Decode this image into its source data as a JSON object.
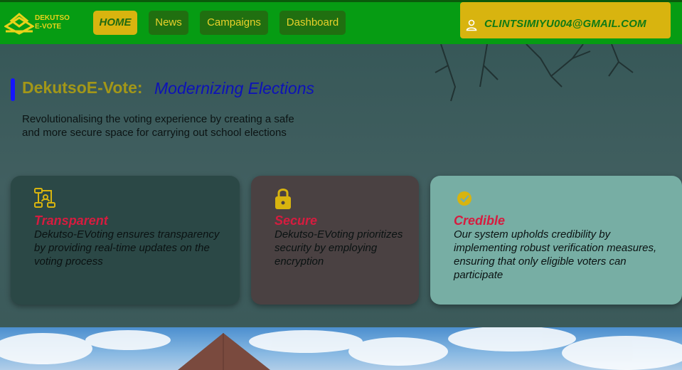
{
  "brand": {
    "name_line1": "DEKUTSO",
    "name_line2": "E-VOTE",
    "icon": "ballot-box-icon"
  },
  "nav": {
    "items": [
      {
        "label": "HOME",
        "active": true
      },
      {
        "label": "News",
        "active": false
      },
      {
        "label": "Campaigns",
        "active": false
      },
      {
        "label": "Dashboard",
        "active": false
      }
    ]
  },
  "user": {
    "email": "CLINTSIMIYU004@GMAIL.COM",
    "icon": "user-icon"
  },
  "hero": {
    "title": "DekutsoE-Vote:",
    "title_accent": "Modernizing Elections",
    "intro": "Revolutionalising the voting experience by creating a safe and more secure space for carrying out school elections"
  },
  "cards": [
    {
      "icon": "network-people-icon",
      "title": "Transparent",
      "text": "Dekutso-EVoting ensures transparency by providing real-time updates on the voting process"
    },
    {
      "icon": "lock-icon",
      "title": "Secure",
      "text": "Dekutso-EVoting prioritizes security by employing encryption"
    },
    {
      "icon": "verified-check-icon",
      "title": "Credible",
      "text": "Our system upholds credibility by implementing robust verification measures, ensuring that only eligible voters can participate"
    }
  ],
  "colors": {
    "navbar": "#069c13",
    "accent_yellow": "#d8b40f",
    "title_blue": "#0d12b8",
    "card_title_red": "#d61c3f"
  }
}
